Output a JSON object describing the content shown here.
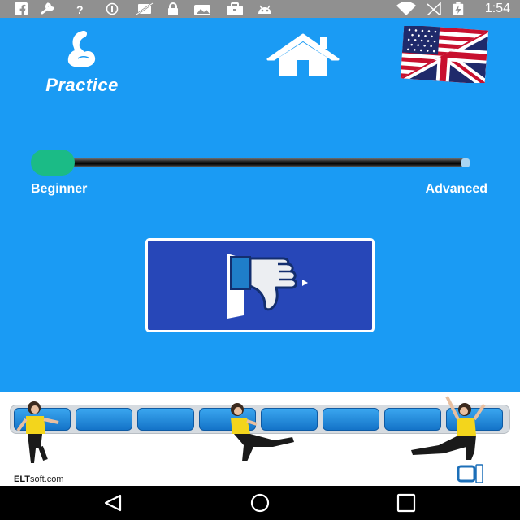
{
  "status_bar": {
    "time": "1:54",
    "icons": [
      "facebook-icon",
      "wrench-icon",
      "question-icon",
      "blocked-icon",
      "no-cell-icon",
      "lock-icon",
      "photo-icon",
      "briefcase-icon",
      "android-icon",
      "wifi-icon",
      "no-signal-icon",
      "battery-charging-icon"
    ]
  },
  "header": {
    "practice_label": "Practice",
    "practice_icon": "flexed-arm-icon",
    "home_icon": "home-icon",
    "language_icon": "us-uk-flag-icon"
  },
  "level_slider": {
    "min_label": "Beginner",
    "max_label": "Advanced",
    "value": 0,
    "thumb_color": "#1bbb86"
  },
  "feedback": {
    "icon": "thumbs-down-icon",
    "button_color": "#2747b8"
  },
  "banner": {
    "site_prefix": "ELT",
    "site_suffix": "soft.com",
    "logo_icon": "eltsoft-logo-icon"
  },
  "nav_bar": {
    "buttons": [
      "back-icon",
      "home-icon",
      "recents-icon"
    ]
  },
  "colors": {
    "app_background": "#1a9bf4",
    "status_bar": "#909090",
    "nav_bar": "#000000"
  }
}
